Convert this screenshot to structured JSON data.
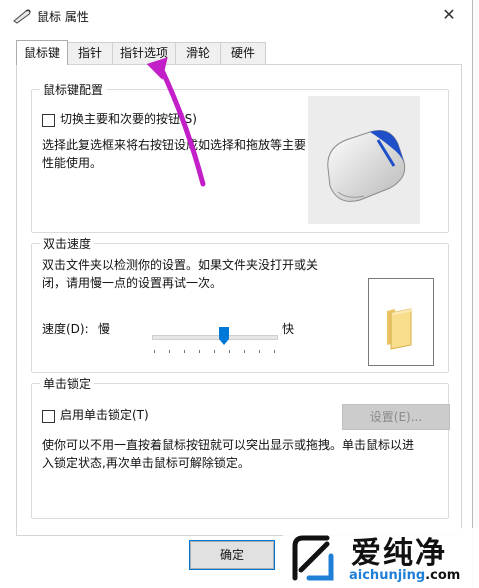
{
  "window": {
    "title": "鼠标 属性",
    "close_glyph": "✕"
  },
  "tabs": [
    {
      "label": "鼠标键",
      "active": true
    },
    {
      "label": "指针",
      "active": false
    },
    {
      "label": "指针选项",
      "active": false
    },
    {
      "label": "滑轮",
      "active": false
    },
    {
      "label": "硬件",
      "active": false
    }
  ],
  "button_config": {
    "title": "鼠标键配置",
    "checkbox_label": "切换主要和次要的按钮(S)",
    "checked": false,
    "description_line1": "选择此复选框来将右按钮设成如选择和拖放等主要",
    "description_line2": "性能使用。",
    "preview_icon": "mouse-icon"
  },
  "double_click": {
    "title": "双击速度",
    "description_line1": "双击文件夹以检测你的设置。如果文件夹没打开或关",
    "description_line2": "闭，请用慢一点的设置再试一次。",
    "speed_label": "速度(D):",
    "slow_label": "慢",
    "fast_label": "快",
    "speed_fraction": 0.55,
    "test_icon": "folder-icon"
  },
  "click_lock": {
    "title": "单击锁定",
    "checkbox_label": "启用单击锁定(T)",
    "checked": false,
    "settings_button": "设置(E)...",
    "description_line1": "使你可以不用一直按着鼠标按钮就可以突出显示或拖拽。单击鼠标以进",
    "description_line2": "入锁定状态,再次单击鼠标可解除锁定。"
  },
  "footer": {
    "ok_button": "确定"
  },
  "watermark": {
    "brand": "爱纯净",
    "url_prefix": "aichunjing",
    "url_suffix": ".com"
  },
  "colors": {
    "accent": "#0078d7",
    "arrow": "#c21fc8",
    "mouse_blue": "#1f4fc8"
  }
}
